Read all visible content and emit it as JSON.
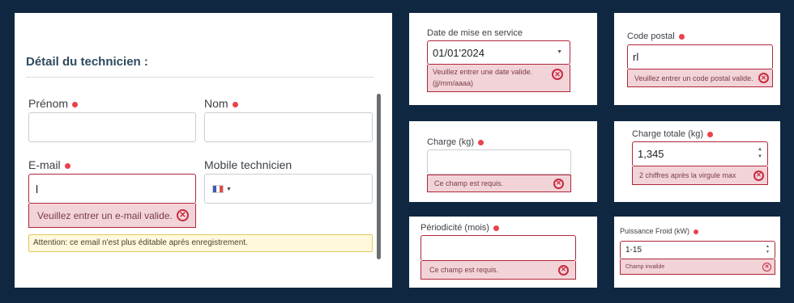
{
  "technician": {
    "title": "Détail du technicien :",
    "first_name_label": "Prénom",
    "last_name_label": "Nom",
    "email_label": "E-mail",
    "email_value": "l",
    "email_error": "Veuillez entrer un e-mail valide.",
    "mobile_label": "Mobile technicien",
    "attention": "Attention: ce email n'est plus éditable aprés enregistrement."
  },
  "date_panel": {
    "label": "Date de mise en service",
    "value": "01/01'2024",
    "error_line1": "Veuillez entrer une date valide.",
    "error_line2": "(jj/mm/aaaa)"
  },
  "postal_panel": {
    "label": "Code postal",
    "value": "rl",
    "error": "Veuillez entrer un code postal valide."
  },
  "charge_panel": {
    "label": "Charge (kg)",
    "error": "Ce champ est requis."
  },
  "charge_total_panel": {
    "label": "Charge totale (kg)",
    "value": "1,345",
    "error": "2 chiffres après la virgule max"
  },
  "period_panel": {
    "label": "Périodicité (mois)",
    "error": "Ce champ est requis."
  },
  "power_panel": {
    "label": "Puissance Froid (kW)",
    "value": "1-15",
    "error": "Champ invalide"
  },
  "colors": {
    "background": "#0f2740",
    "required_dot": "#e8434b",
    "error_bg": "#f2d4d8",
    "error_border": "#b0263a",
    "warning_bg": "#fff8dc"
  },
  "icons": [
    "error-x-icon",
    "chevron-down-icon",
    "french-flag-icon",
    "spinner-arrows-icon"
  ]
}
